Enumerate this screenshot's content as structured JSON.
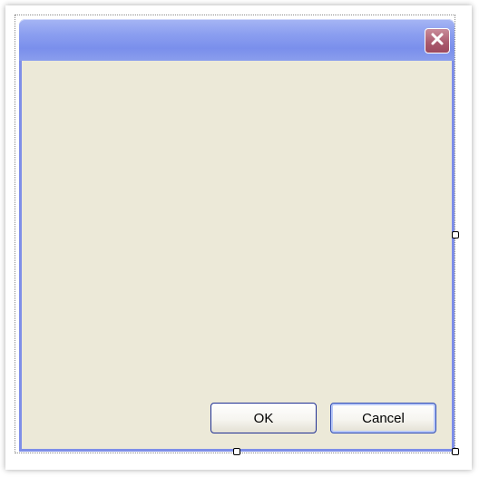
{
  "window": {
    "title": "",
    "close_icon": "close-icon"
  },
  "buttons": {
    "ok_label": "OK",
    "cancel_label": "Cancel"
  },
  "colors": {
    "titlebar": "#8c9ff0",
    "frame": "#7e8ee8",
    "client_background": "#ece9d8",
    "close_button": "#a9596d",
    "button_border": "#1f2f93"
  }
}
